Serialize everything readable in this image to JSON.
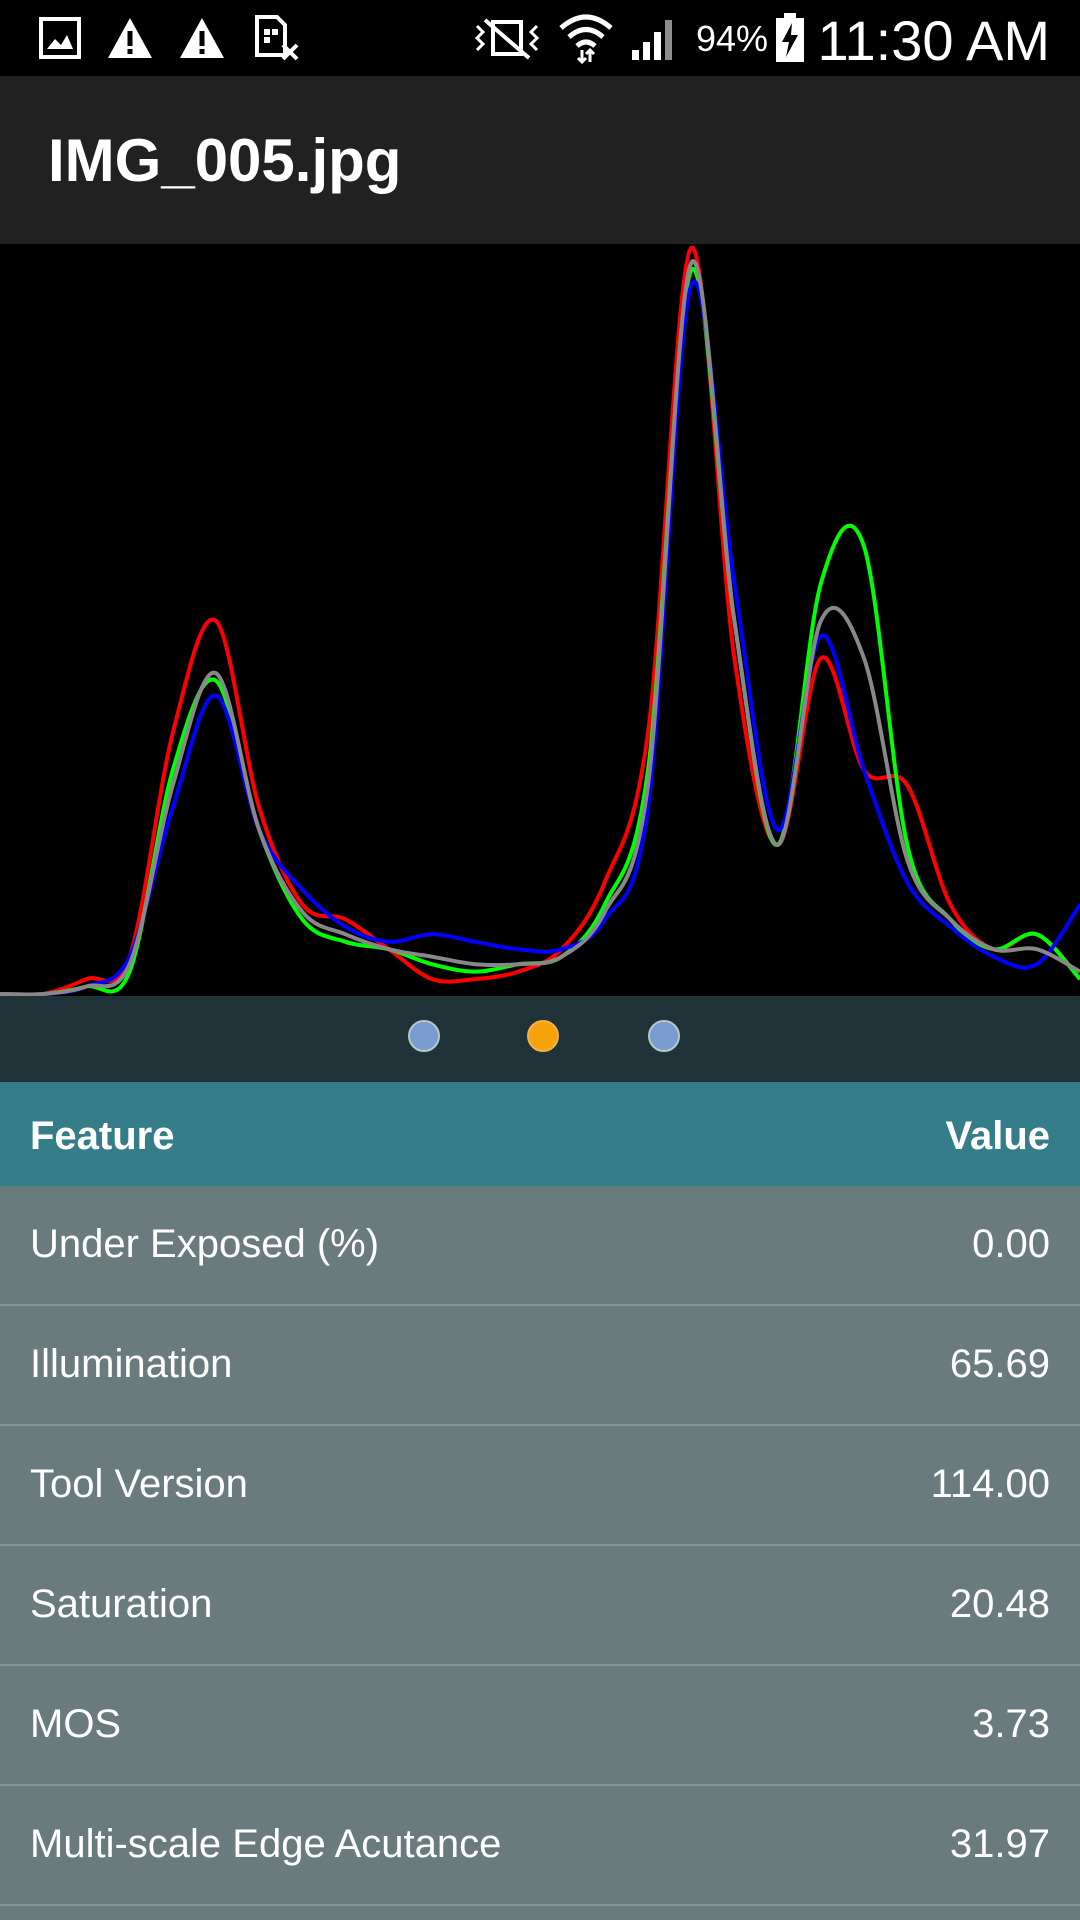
{
  "status_bar": {
    "icons_left": [
      "gallery-icon",
      "warning-icon",
      "warning-icon",
      "sim-error-icon"
    ],
    "icons_right": [
      "vibrate-mute-icon",
      "wifi-icon",
      "signal-icon"
    ],
    "battery_percent": "94%",
    "time": "11:30 AM"
  },
  "app_bar": {
    "title": "IMG_005.jpg"
  },
  "pager": {
    "page_count": 3,
    "active_index": 1,
    "dot_color": "#7a9ccf",
    "active_color": "#f7a10d"
  },
  "table": {
    "header": {
      "feature": "Feature",
      "value": "Value"
    },
    "rows": [
      {
        "feature": "Under Exposed (%)",
        "value": "0.00"
      },
      {
        "feature": "Illumination",
        "value": "65.69"
      },
      {
        "feature": "Tool Version",
        "value": "114.00"
      },
      {
        "feature": "Saturation",
        "value": "20.48"
      },
      {
        "feature": "MOS",
        "value": "3.73"
      },
      {
        "feature": "Multi-scale Edge Acutance",
        "value": "31.97"
      }
    ]
  },
  "chart_data": {
    "type": "line",
    "x": [
      0,
      4,
      8,
      12,
      16,
      20,
      24,
      28,
      32,
      36,
      40,
      44,
      48,
      52,
      56,
      60,
      64,
      68,
      72,
      76,
      80,
      84,
      88,
      92,
      96,
      100
    ],
    "series": [
      {
        "color": "#ff0000",
        "values": [
          0,
          0,
          2,
          5,
          35,
          50,
          25,
          12,
          10,
          6,
          2,
          2,
          3,
          6,
          15,
          35,
          100,
          45,
          20,
          45,
          30,
          28,
          12,
          6,
          8,
          2
        ]
      },
      {
        "color": "#00ff00",
        "values": [
          0,
          0,
          1,
          3,
          30,
          42,
          22,
          10,
          7,
          6,
          4,
          3,
          4,
          5,
          12,
          30,
          97,
          50,
          20,
          55,
          60,
          20,
          10,
          6,
          8,
          2
        ]
      },
      {
        "color": "#0000ff",
        "values": [
          0,
          0,
          1,
          5,
          25,
          40,
          22,
          14,
          9,
          7,
          8,
          7,
          6,
          6,
          10,
          25,
          95,
          55,
          22,
          48,
          30,
          15,
          9,
          5,
          4,
          12
        ]
      },
      {
        "color": "#888888",
        "values": [
          0,
          0,
          1,
          4,
          28,
          43,
          22,
          11,
          8,
          6,
          5,
          4,
          4,
          5,
          11,
          28,
          98,
          50,
          20,
          50,
          45,
          18,
          10,
          6,
          6,
          3
        ]
      }
    ],
    "ylim": [
      0,
      100
    ],
    "grid": false,
    "legend": "none"
  }
}
